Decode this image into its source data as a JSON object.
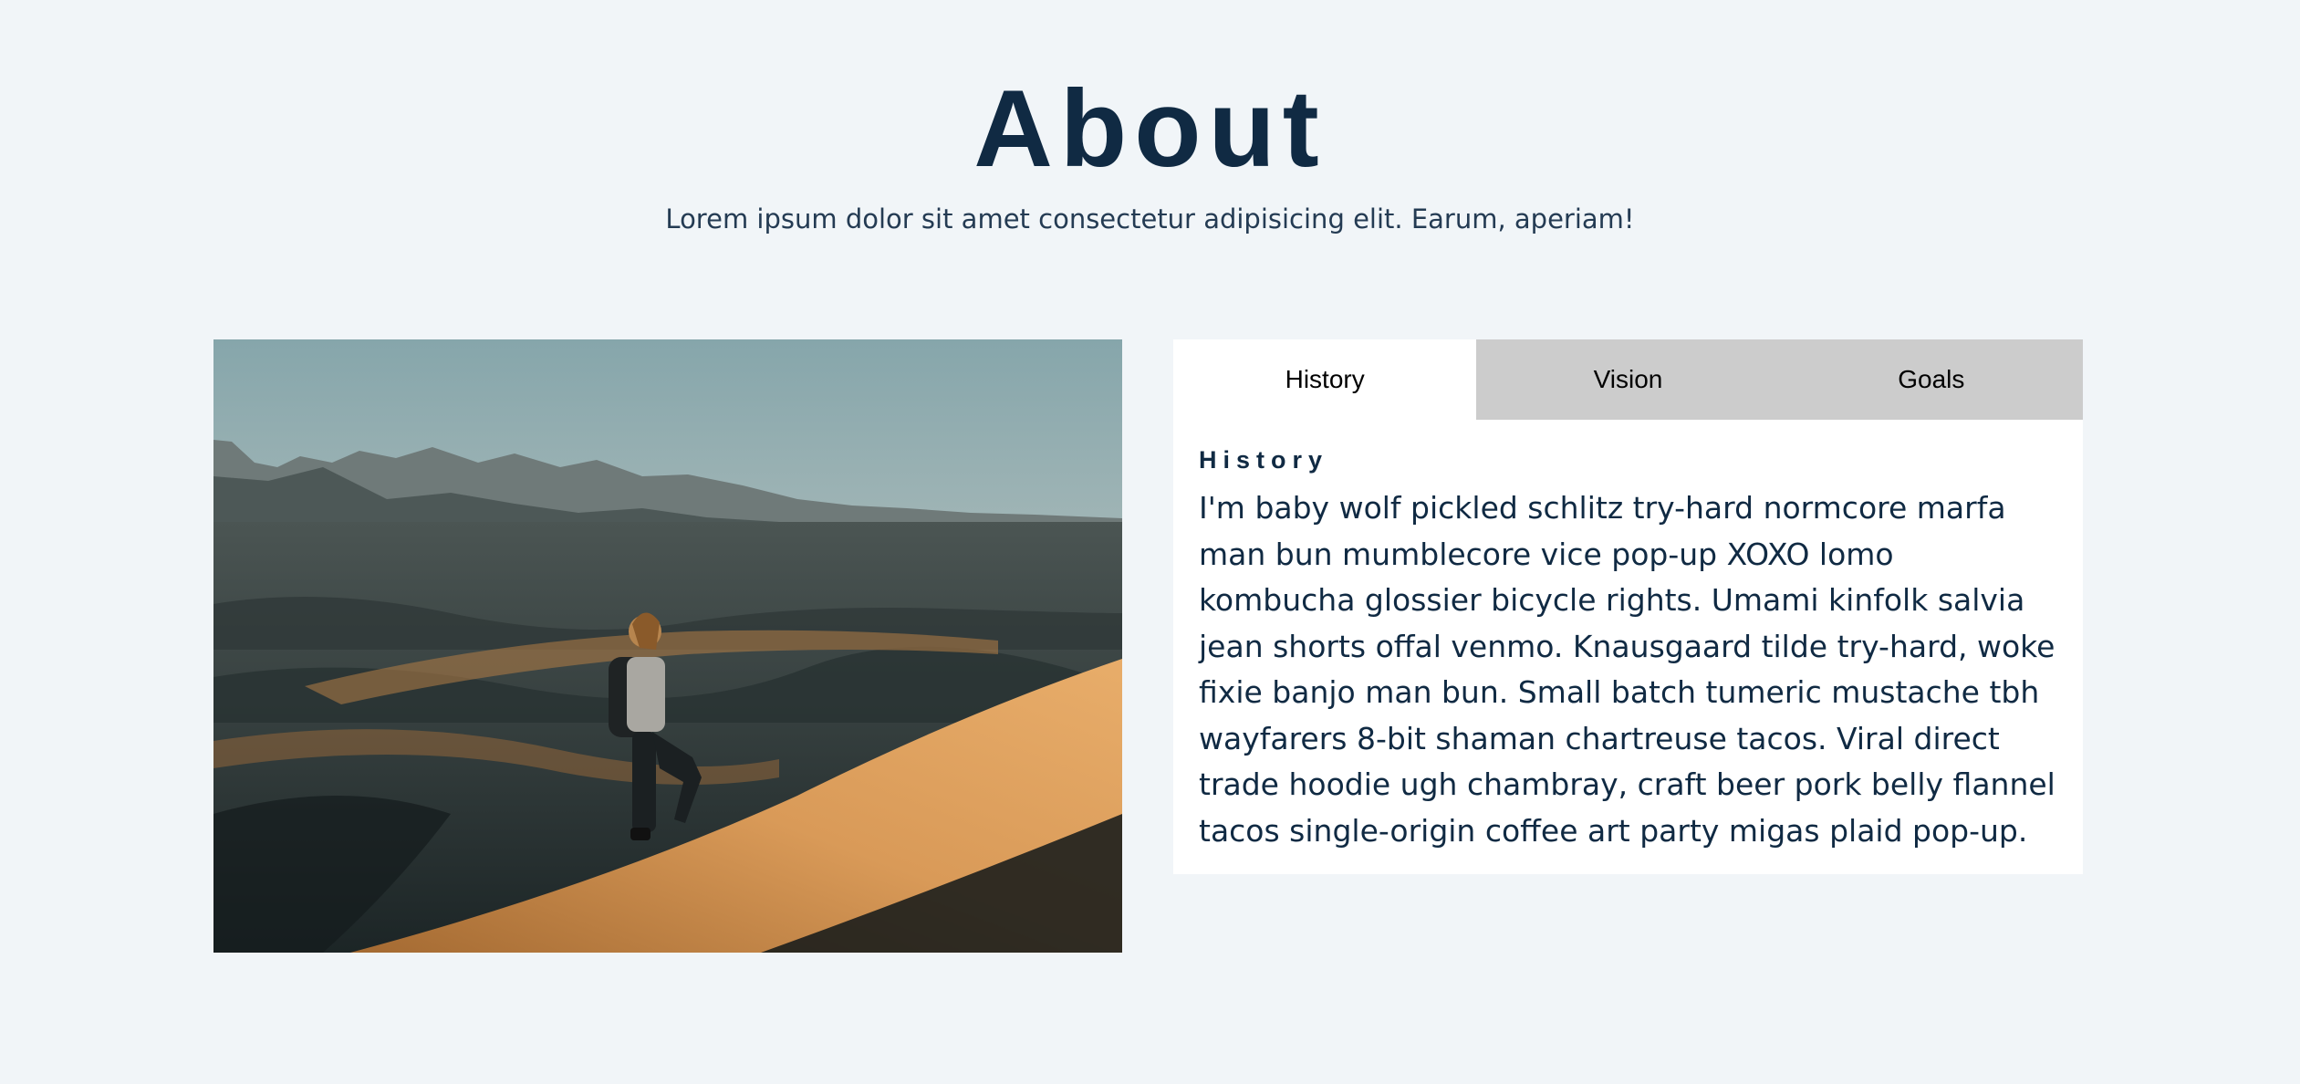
{
  "header": {
    "title": "About",
    "subtitle": "Lorem ipsum dolor sit amet consectetur adipisicing elit. Earum, aperiam!"
  },
  "tabs": [
    {
      "label": "History",
      "active": true
    },
    {
      "label": "Vision",
      "active": false
    },
    {
      "label": "Goals",
      "active": false
    }
  ],
  "content": {
    "heading": "History",
    "text": "I'm baby wolf pickled schlitz try-hard normcore marfa man bun mumblecore vice pop-up XOXO lomo kombucha glossier bicycle rights. Umami kinfolk salvia jean shorts offal venmo. Knausgaard tilde try-hard, woke fixie banjo man bun. Small batch tumeric mustache tbh wayfarers 8-bit shaman chartreuse tacos. Viral direct trade hoodie ugh chambray, craft beer pork belly flannel tacos single-origin coffee art party migas plaid pop-up."
  },
  "colors": {
    "background": "#f1f5f8",
    "heading": "#102a43",
    "tab_inactive": "#cccccc",
    "tab_active": "#ffffff"
  }
}
